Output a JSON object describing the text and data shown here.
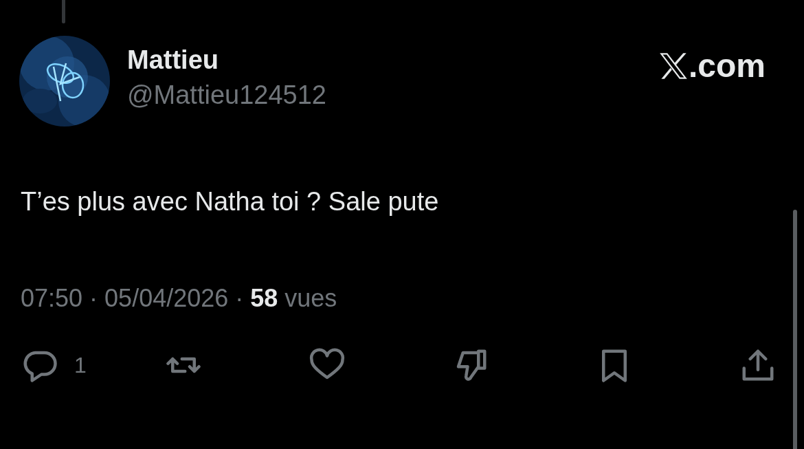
{
  "author": {
    "name": "Mattieu",
    "handle": "@Mattieu124512"
  },
  "brand": {
    "suffix": ".com"
  },
  "text": "T’es plus avec Natha toi ? Sale pute",
  "meta": {
    "time": "07:50",
    "separator": "·",
    "date": "05/04/2026",
    "views": "58",
    "views_label": "vues"
  },
  "actions": [
    {
      "kind": "reply",
      "count": "1"
    },
    {
      "kind": "repost"
    },
    {
      "kind": "like"
    },
    {
      "kind": "dislike"
    },
    {
      "kind": "bookmark"
    },
    {
      "kind": "share"
    }
  ]
}
